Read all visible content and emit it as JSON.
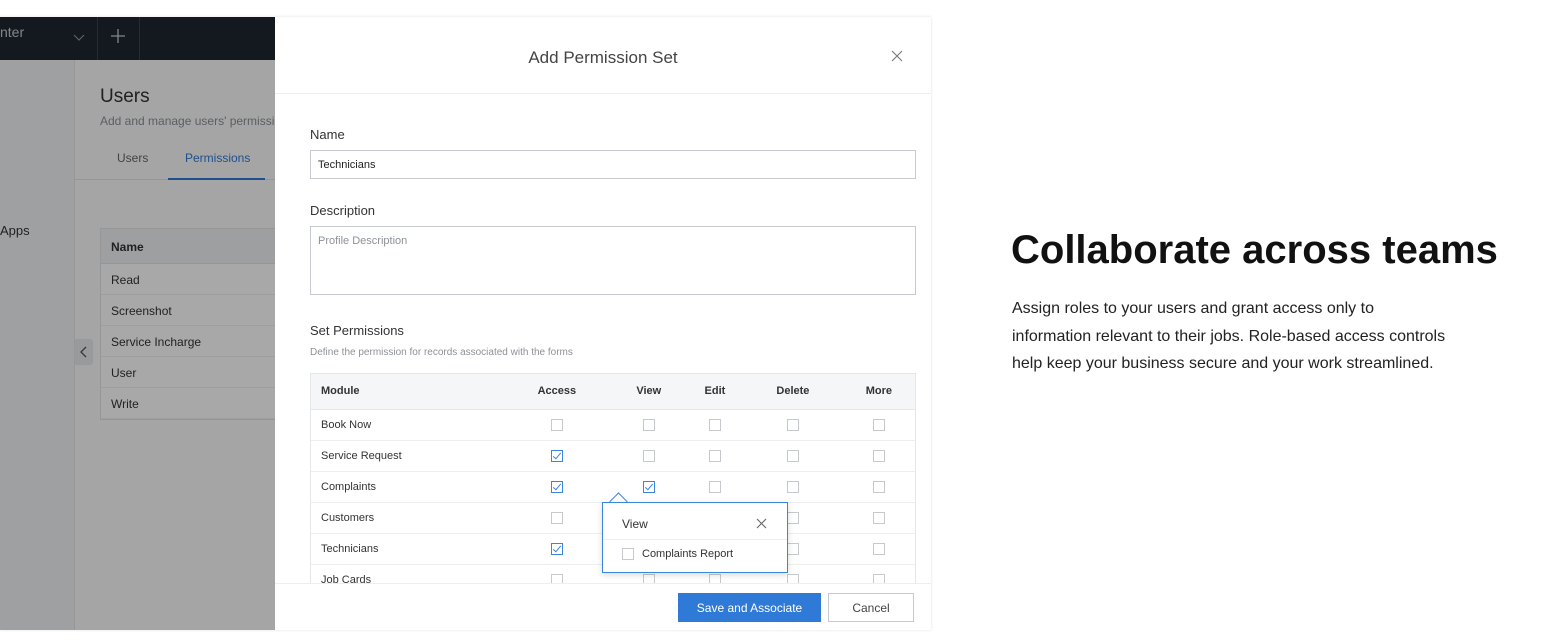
{
  "app": {
    "brand_fragment": "nter",
    "sidebar_apps_label": "Apps",
    "page_title": "Users",
    "page_subtitle": "Add and manage users' permissio",
    "tabs": [
      {
        "label": "Users"
      },
      {
        "label": "Permissions"
      }
    ],
    "table": {
      "header": "Name",
      "rows": [
        "Read",
        "Screenshot",
        "Service Incharge",
        "User",
        "Write"
      ]
    }
  },
  "modal": {
    "title": "Add Permission Set",
    "name_label": "Name",
    "name_value": "Technicians",
    "description_label": "Description",
    "description_placeholder": "Profile Description",
    "set_permissions_label": "Set Permissions",
    "set_permissions_hint": "Define the permission for records associated with the forms",
    "columns": [
      "Module",
      "Access",
      "View",
      "Edit",
      "Delete",
      "More"
    ],
    "rows": [
      {
        "module": "Book Now",
        "access": false,
        "view": false,
        "edit": false,
        "delete": false,
        "more": false
      },
      {
        "module": "Service Request",
        "access": true,
        "view": false,
        "edit": false,
        "delete": false,
        "more": false
      },
      {
        "module": "Complaints",
        "access": true,
        "view": true,
        "edit": false,
        "delete": false,
        "more": false
      },
      {
        "module": "Customers",
        "access": false,
        "view": false,
        "edit": false,
        "delete": false,
        "more": false
      },
      {
        "module": "Technicians",
        "access": true,
        "view": false,
        "edit": false,
        "delete": false,
        "more": false
      },
      {
        "module": "Job Cards",
        "access": false,
        "view": false,
        "edit": false,
        "delete": false,
        "more": false
      }
    ],
    "popup": {
      "title": "View",
      "item_label": "Complaints Report",
      "item_checked": false
    },
    "save_label": "Save and Associate",
    "cancel_label": "Cancel"
  },
  "hero": {
    "title": "Collaborate across teams",
    "body": "Assign roles to your users and grant access only to information relevant to their jobs. Role-based access controls help keep your business secure and your work streamlined."
  },
  "colors": {
    "accent": "#2f7ad6",
    "topbar": "#1d2630"
  }
}
